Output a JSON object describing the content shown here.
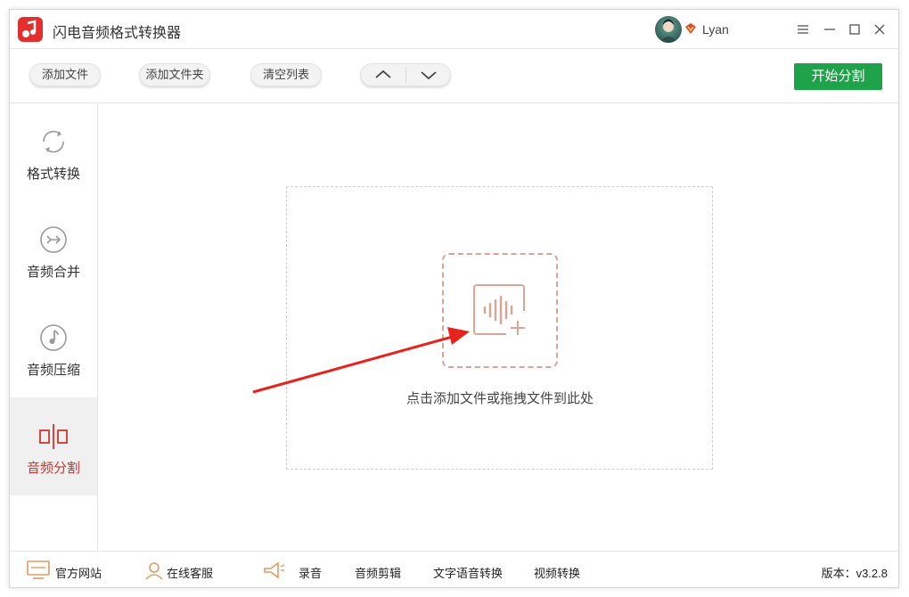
{
  "app": {
    "title": "闪电音频格式转换器"
  },
  "user": {
    "name": "Lyan"
  },
  "toolbar": {
    "add_file": "添加文件",
    "add_folder": "添加文件夹",
    "clear_list": "清空列表",
    "start": "开始分割"
  },
  "sidebar": {
    "items": [
      {
        "label": "格式转换",
        "icon": "refresh-icon"
      },
      {
        "label": "音频合并",
        "icon": "merge-icon"
      },
      {
        "label": "音频压缩",
        "icon": "music-note-icon"
      },
      {
        "label": "音频分割",
        "icon": "split-icon",
        "active": true
      }
    ]
  },
  "main": {
    "drop_hint": "点击添加文件或拖拽文件到此处"
  },
  "footer": {
    "website": "官方网站",
    "support": "在线客服",
    "record": "录音",
    "audio_edit": "音频剪辑",
    "tts": "文字语音转换",
    "video": "视频转换",
    "version": "版本：v3.2.8"
  },
  "colors": {
    "accent": "#d0352e",
    "start_button": "#1fa34a",
    "add_box": "#d9a596",
    "arrow": "#e8231d"
  }
}
